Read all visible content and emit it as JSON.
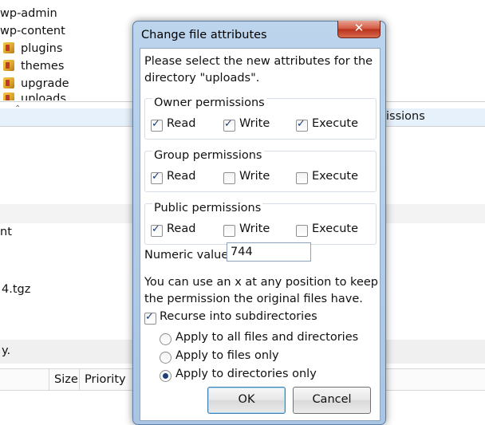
{
  "background": {
    "tree_items": [
      {
        "label": "wp-admin",
        "icon": "folder-icon"
      },
      {
        "label": "wp-content",
        "icon": "folder-icon"
      },
      {
        "label": "plugins",
        "icon": "folder-icon"
      },
      {
        "label": "themes",
        "icon": "folder-icon"
      },
      {
        "label": "upgrade",
        "icon": "folder-icon"
      },
      {
        "label": "uploads",
        "icon": "folder-icon"
      }
    ],
    "column_permissions_fragment": "issions",
    "file_fragment_1": "nt",
    "file_fragment_2": "4.tgz",
    "file_fragment_3": "y.",
    "queue_columns": {
      "size": "Size",
      "priority": "Priority"
    }
  },
  "dialog": {
    "title": "Change file attributes",
    "close_glyph": "✕",
    "instruction": "Please select the new attributes for the directory \"uploads\".",
    "groups": [
      {
        "title": "Owner permissions",
        "options": [
          {
            "label": "Read",
            "checked": true
          },
          {
            "label": "Write",
            "checked": true
          },
          {
            "label": "Execute",
            "checked": true
          }
        ]
      },
      {
        "title": "Group permissions",
        "options": [
          {
            "label": "Read",
            "checked": true
          },
          {
            "label": "Write",
            "checked": false
          },
          {
            "label": "Execute",
            "checked": false
          }
        ]
      },
      {
        "title": "Public permissions",
        "options": [
          {
            "label": "Read",
            "checked": true
          },
          {
            "label": "Write",
            "checked": false
          },
          {
            "label": "Execute",
            "checked": false
          }
        ]
      }
    ],
    "numeric_label": "Numeric value:",
    "numeric_value": "744",
    "hint": "You can use an x at any position to keep the permission the original files have.",
    "recurse": {
      "label": "Recurse into subdirectories",
      "checked": true
    },
    "apply_options": [
      {
        "label": "Apply to all files and directories",
        "selected": false
      },
      {
        "label": "Apply to files only",
        "selected": false
      },
      {
        "label": "Apply to directories only",
        "selected": true
      }
    ],
    "ok_label": "OK",
    "cancel_label": "Cancel"
  }
}
